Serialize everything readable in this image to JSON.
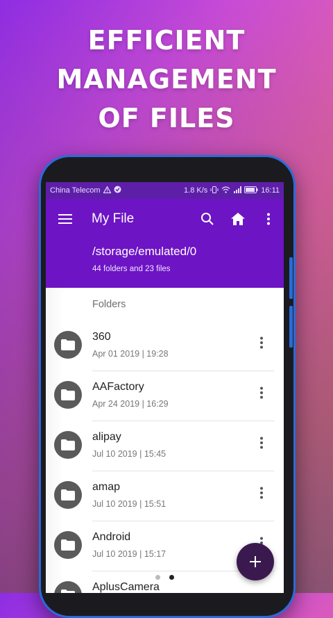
{
  "headline": {
    "line1": "EFFICIENT",
    "line2": "MANAGEMENT",
    "line3": "OF FILES"
  },
  "statusbar": {
    "carrier": "China Telecom",
    "speed": "1.8 K/s",
    "time": "16:11"
  },
  "appbar": {
    "title": "My File",
    "icons": [
      "menu-icon",
      "search-icon",
      "home-icon",
      "more-vert-icon"
    ]
  },
  "path": {
    "current": "/storage/emulated/0",
    "summary": "44 folders and 23 files"
  },
  "folders_header": "Folders",
  "folders": [
    {
      "name": "360",
      "date": "Apr 01 2019 | 19:28"
    },
    {
      "name": "AAFactory",
      "date": "Apr 24 2019 | 16:29"
    },
    {
      "name": "alipay",
      "date": "Jul 10 2019 | 15:45"
    },
    {
      "name": "amap",
      "date": "Jul 10 2019 | 15:51"
    },
    {
      "name": "Android",
      "date": "Jul 10 2019 | 15:17"
    },
    {
      "name": "AplusCamera",
      "date": ""
    }
  ],
  "colors": {
    "toolbar": "#6d14c5",
    "statusbar": "#5e1fa8",
    "fab": "#3a1a4e",
    "folder_avatar": "#5a5a5a"
  },
  "pager": {
    "count": 2,
    "active_index": 1
  }
}
